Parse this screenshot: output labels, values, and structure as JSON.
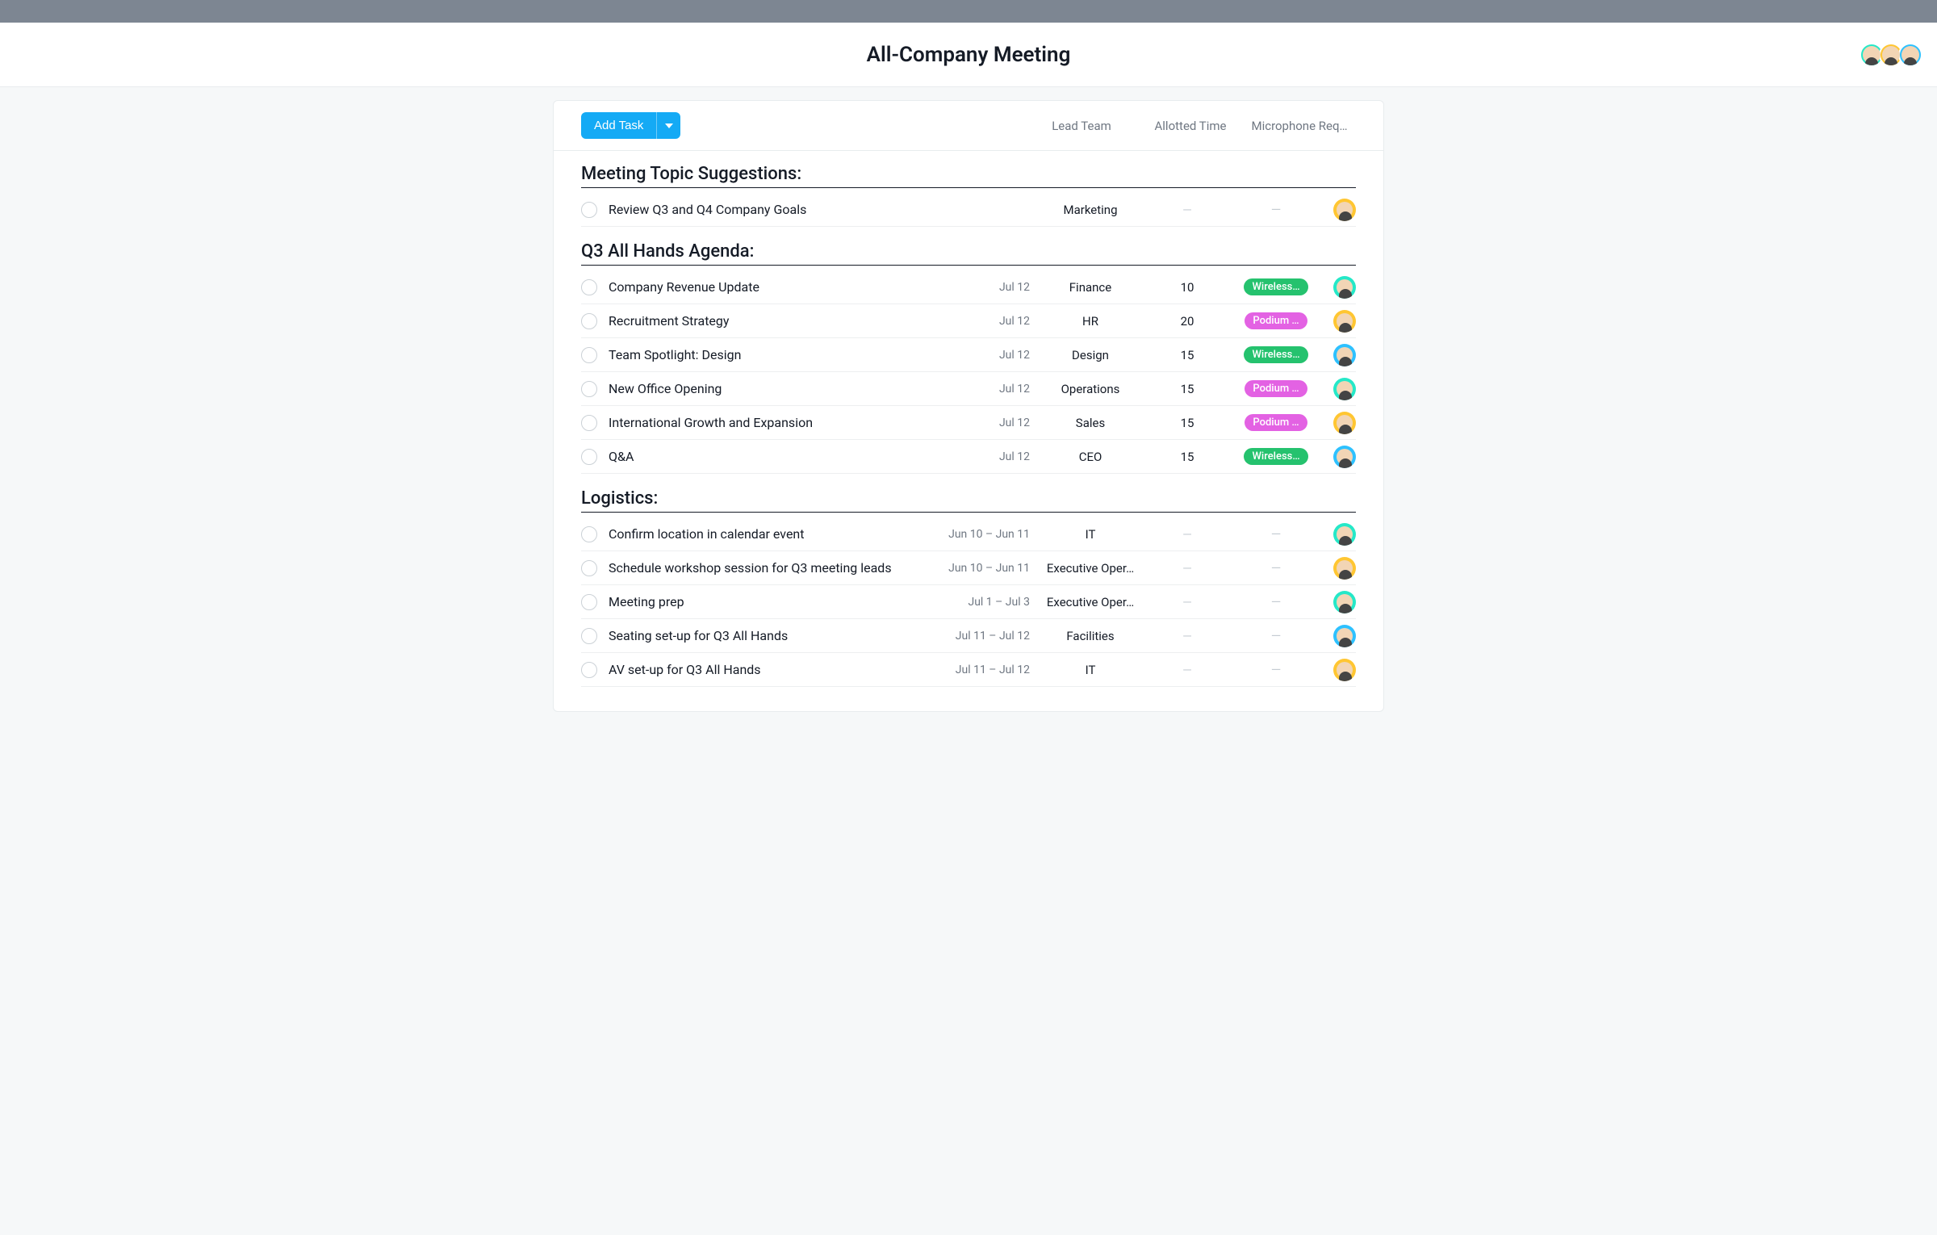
{
  "header": {
    "title": "All-Company Meeting",
    "avatars": [
      "green",
      "yellow",
      "blue"
    ]
  },
  "toolbar": {
    "add_task_label": "Add Task",
    "columns": {
      "lead": "Lead Team",
      "time": "Allotted Time",
      "mic": "Microphone Req…"
    }
  },
  "mic_labels": {
    "wireless": "Wireless…",
    "podium": "Podium …"
  },
  "sections": [
    {
      "title": "Meeting Topic Suggestions:",
      "tasks": [
        {
          "name": "Review Q3 and Q4 Company Goals",
          "date": "",
          "lead": "Marketing",
          "time": "—",
          "mic": "",
          "assignee": "yellow"
        }
      ]
    },
    {
      "title": "Q3 All Hands Agenda:",
      "tasks": [
        {
          "name": "Company Revenue Update",
          "date": "Jul 12",
          "lead": "Finance",
          "time": "10",
          "mic": "wireless",
          "assignee": "green"
        },
        {
          "name": "Recruitment Strategy",
          "date": "Jul 12",
          "lead": "HR",
          "time": "20",
          "mic": "podium",
          "assignee": "yellow"
        },
        {
          "name": "Team Spotlight: Design",
          "date": "Jul 12",
          "lead": "Design",
          "time": "15",
          "mic": "wireless",
          "assignee": "blue"
        },
        {
          "name": "New Office Opening",
          "date": "Jul 12",
          "lead": "Operations",
          "time": "15",
          "mic": "podium",
          "assignee": "green"
        },
        {
          "name": "International Growth and Expansion",
          "date": "Jul 12",
          "lead": "Sales",
          "time": "15",
          "mic": "podium",
          "assignee": "yellow"
        },
        {
          "name": "Q&A",
          "date": "Jul 12",
          "lead": "CEO",
          "time": "15",
          "mic": "wireless",
          "assignee": "blue"
        }
      ]
    },
    {
      "title": "Logistics:",
      "tasks": [
        {
          "name": "Confirm location in calendar event",
          "date": "Jun 10 – Jun 11",
          "lead": "IT",
          "time": "—",
          "mic": "",
          "assignee": "green"
        },
        {
          "name": "Schedule workshop session for Q3 meeting leads",
          "date": "Jun 10 – Jun 11",
          "lead": "Executive Oper…",
          "time": "—",
          "mic": "",
          "assignee": "yellow"
        },
        {
          "name": "Meeting prep",
          "date": "Jul 1 – Jul 3",
          "lead": "Executive Oper…",
          "time": "—",
          "mic": "",
          "assignee": "green"
        },
        {
          "name": "Seating set-up for Q3 All Hands",
          "date": "Jul 11 – Jul 12",
          "lead": "Facilities",
          "time": "—",
          "mic": "",
          "assignee": "blue"
        },
        {
          "name": "AV set-up for Q3 All Hands",
          "date": "Jul 11 – Jul 12",
          "lead": "IT",
          "time": "—",
          "mic": "",
          "assignee": "yellow"
        }
      ]
    }
  ]
}
